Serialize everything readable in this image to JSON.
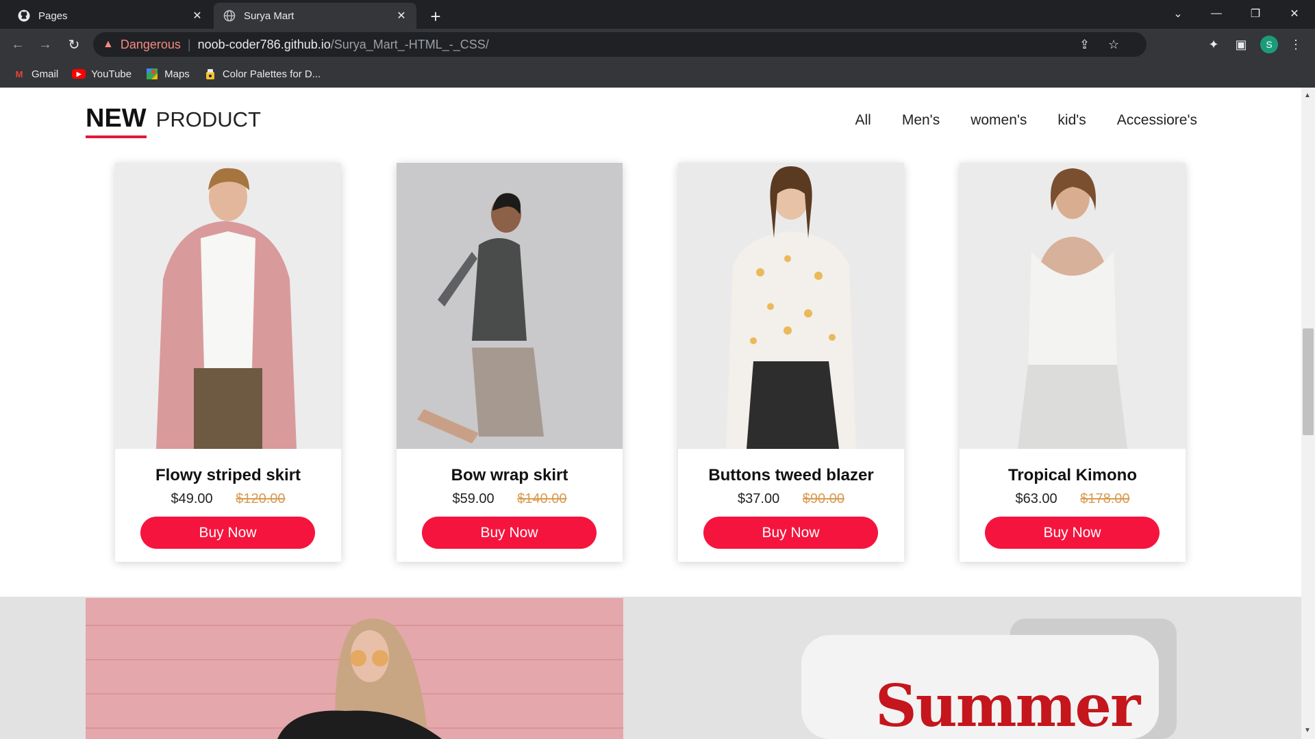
{
  "browser": {
    "tabs": [
      {
        "title": "Pages",
        "icon": "github-icon"
      },
      {
        "title": "Surya Mart",
        "icon": "globe-icon"
      }
    ],
    "address": {
      "security_label": "Dangerous",
      "host": "noob-coder786.github.io",
      "path": "/Surya_Mart_-HTML_-_CSS/"
    },
    "profile_initial": "S",
    "bookmarks": [
      {
        "label": "Gmail",
        "icon": "gmail-icon"
      },
      {
        "label": "YouTube",
        "icon": "youtube-icon"
      },
      {
        "label": "Maps",
        "icon": "maps-icon"
      },
      {
        "label": "Color Palettes for D...",
        "icon": "palette-icon"
      }
    ]
  },
  "section": {
    "title_bold": "NEW",
    "title_light": "PRODUCT",
    "accent_color": "#e31837",
    "filters": [
      "All",
      "Men's",
      "women's",
      "kid's",
      "Accessiore's"
    ]
  },
  "products": [
    {
      "name": "Flowy striped skirt",
      "price": "$49.00",
      "old_price": "$120.00",
      "button": "Buy Now"
    },
    {
      "name": "Bow wrap skirt",
      "price": "$59.00",
      "old_price": "$140.00",
      "button": "Buy Now"
    },
    {
      "name": "Buttons tweed blazer",
      "price": "$37.00",
      "old_price": "$90.00",
      "button": "Buy Now"
    },
    {
      "name": "Tropical Kimono",
      "price": "$63.00",
      "old_price": "$178.00",
      "button": "Buy Now"
    }
  ],
  "banner": {
    "headline": "Summer"
  },
  "colors": {
    "buy_button": "#f5143d",
    "old_price": "#d89b51",
    "headline": "#c4161c"
  }
}
